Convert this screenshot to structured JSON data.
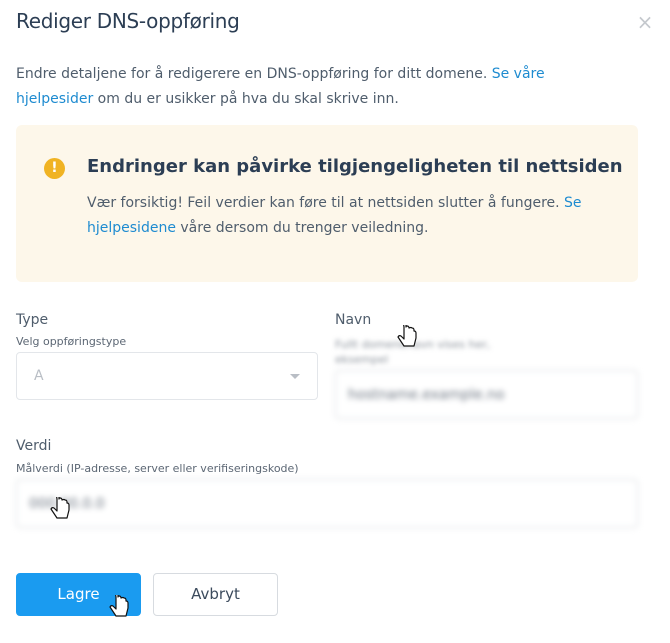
{
  "dialog": {
    "title": "Rediger DNS-oppføring",
    "close_icon": "×",
    "intro_text": "Endre detaljene for å redigerere en DNS-oppføring for ditt domene. ",
    "intro_link": "Se våre hjelpesider",
    "intro_suffix": " om du er usikker på hva du skal skrive inn."
  },
  "alert": {
    "icon": "!",
    "title": "Endringer kan påvirke tilgjengeligheten til nettsiden",
    "text": "Vær forsiktig! Feil verdier kan føre til at nettsiden slutter å fungere. ",
    "link": "Se hjelpesidene",
    "suffix": " våre dersom du trenger veiledning.",
    "color": "#f0b323"
  },
  "form": {
    "type_label": "Type",
    "type_sublabel": "Velg oppføringstype",
    "type_value": "A",
    "name_label": "Navn",
    "name_hint": "Fullt domenenavn vises her, eksempel",
    "name_value": "hostname.example.no",
    "value_label": "Verdi",
    "value_sublabel": "Målverdi (IP-adresse, server eller verifiseringskode)",
    "value_value": "000.00.0.0"
  },
  "actions": {
    "save_label": "Lagre",
    "cancel_label": "Avbryt"
  },
  "colors": {
    "accent": "#1a9bf0",
    "link": "#1e8bd0",
    "alert_bg": "#fdf7ea"
  }
}
